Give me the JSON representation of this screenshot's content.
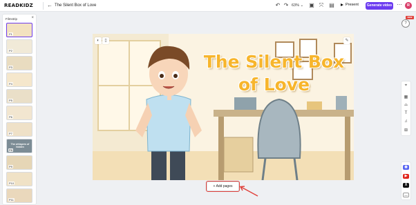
{
  "header": {
    "logo": "READKIDZ",
    "back_icon": "arrow-left-icon",
    "title": "The Silent Box of Love",
    "zoom": "63% ⌄",
    "present_label": "Present",
    "generate_label": "Generate video",
    "avatar_initial": "R",
    "accent_color": "#6c3cf0"
  },
  "filmstrip": {
    "title": "Filmstrip",
    "pages": [
      {
        "label": "P1",
        "text": ""
      },
      {
        "label": "P2",
        "text": ""
      },
      {
        "label": "P3",
        "text": ""
      },
      {
        "label": "P4",
        "text": ""
      },
      {
        "label": "P5",
        "text": ""
      },
      {
        "label": "P6",
        "text": ""
      },
      {
        "label": "P7",
        "text": ""
      },
      {
        "label": "P8",
        "text": "The whispers of hidden"
      },
      {
        "label": "P9",
        "text": ""
      },
      {
        "label": "P10",
        "text": ""
      },
      {
        "label": "P11",
        "text": ""
      }
    ]
  },
  "canvas": {
    "title": "The Silent Box of Love"
  },
  "add_pages_label": "Add pages",
  "right_rail": {
    "new_badge": "NEW",
    "help": "?",
    "tools": [
      "layout-icon",
      "image-icon",
      "text-icon",
      "music-icon",
      "grid-icon"
    ]
  },
  "social": {
    "items": [
      "discord-icon",
      "youtube-icon",
      "x-icon",
      "chat-icon"
    ]
  }
}
